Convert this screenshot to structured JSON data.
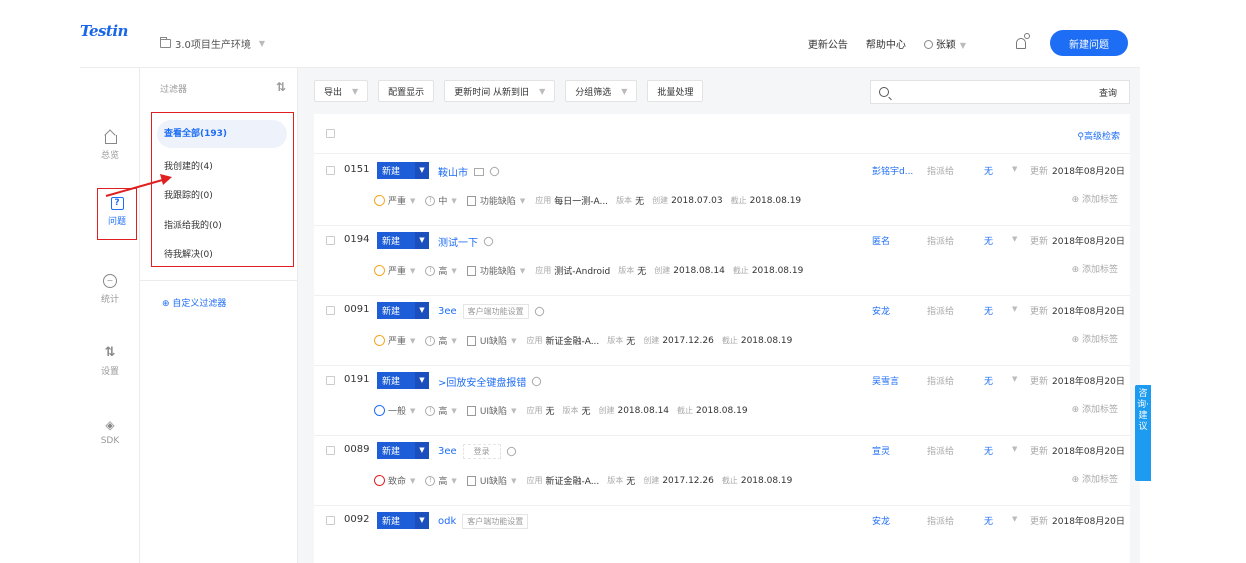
{
  "app": {
    "logo": "Testin"
  },
  "header": {
    "project": "3.0项目生产环境",
    "announcement": "更新公告",
    "help": "帮助中心",
    "user": "张颖",
    "new_issue": "新建问题"
  },
  "nav": {
    "home": "总览",
    "issues": "问题",
    "stats": "统计",
    "settings": "设置",
    "sdk": "SDK"
  },
  "filters": {
    "title": "过滤器",
    "items": [
      "查看全部(193)",
      "我创建的(4)",
      "我跟踪的(0)",
      "指派给我的(0)",
      "待我解决(0)"
    ],
    "custom": "自定义过滤器"
  },
  "toolbar": {
    "export": "导出",
    "config": "配置显示",
    "sort": "更新时间 从新到旧",
    "group": "分组筛选",
    "batch": "批量处理",
    "search_placeholder": "",
    "search_btn": "查询",
    "advanced": "高级检索"
  },
  "labels": {
    "assign": "指派给",
    "none": "无",
    "updated": "更新",
    "app": "应用",
    "version": "版本",
    "created": "创建",
    "deadline": "截止",
    "add_tag": "添加标签"
  },
  "issues": [
    {
      "id": "0151",
      "status": "新建",
      "title": "鞍山市",
      "tag": "",
      "owner": "彭铭宇d...",
      "updated": "2018年08月20日",
      "severity": "严重",
      "sev_color": "#f5a623",
      "priority": "中",
      "type": "功能缺陷",
      "app": "每日一测-A...",
      "version": "无",
      "created": "2018.07.03",
      "deadline": "2018.08.19"
    },
    {
      "id": "0194",
      "status": "新建",
      "title": "测试一下",
      "tag": "",
      "owner": "匿名",
      "updated": "2018年08月20日",
      "severity": "严重",
      "sev_color": "#f5a623",
      "priority": "高",
      "type": "功能缺陷",
      "app": "测试-Android",
      "version": "无",
      "created": "2018.08.14",
      "deadline": "2018.08.19"
    },
    {
      "id": "0091",
      "status": "新建",
      "title": "3ee",
      "tag": "客户端功能设置",
      "owner": "安龙",
      "updated": "2018年08月20日",
      "severity": "严重",
      "sev_color": "#f5a623",
      "priority": "高",
      "type": "UI缺陷",
      "app": "新证金融-A...",
      "version": "无",
      "created": "2017.12.26",
      "deadline": "2018.08.19"
    },
    {
      "id": "0191",
      "status": "新建",
      "title": ">回放安全键盘报错",
      "tag": "",
      "owner": "吴雪言",
      "updated": "2018年08月20日",
      "severity": "一般",
      "sev_color": "#1d6df5",
      "priority": "高",
      "type": "UI缺陷",
      "app": "无",
      "version": "无",
      "created": "2018.08.14",
      "deadline": "2018.08.19"
    },
    {
      "id": "0089",
      "status": "新建",
      "title": "3ee",
      "tag": "登录",
      "owner": "宣灵",
      "updated": "2018年08月20日",
      "severity": "致命",
      "sev_color": "#e02020",
      "priority": "高",
      "type": "UI缺陷",
      "app": "新证金融-A...",
      "version": "无",
      "created": "2017.12.26",
      "deadline": "2018.08.19"
    },
    {
      "id": "0092",
      "status": "新建",
      "title": "odk",
      "tag": "客户端功能设置",
      "owner": "安龙",
      "updated": "2018年08月20日"
    }
  ],
  "side_tab": "咨询·建议"
}
